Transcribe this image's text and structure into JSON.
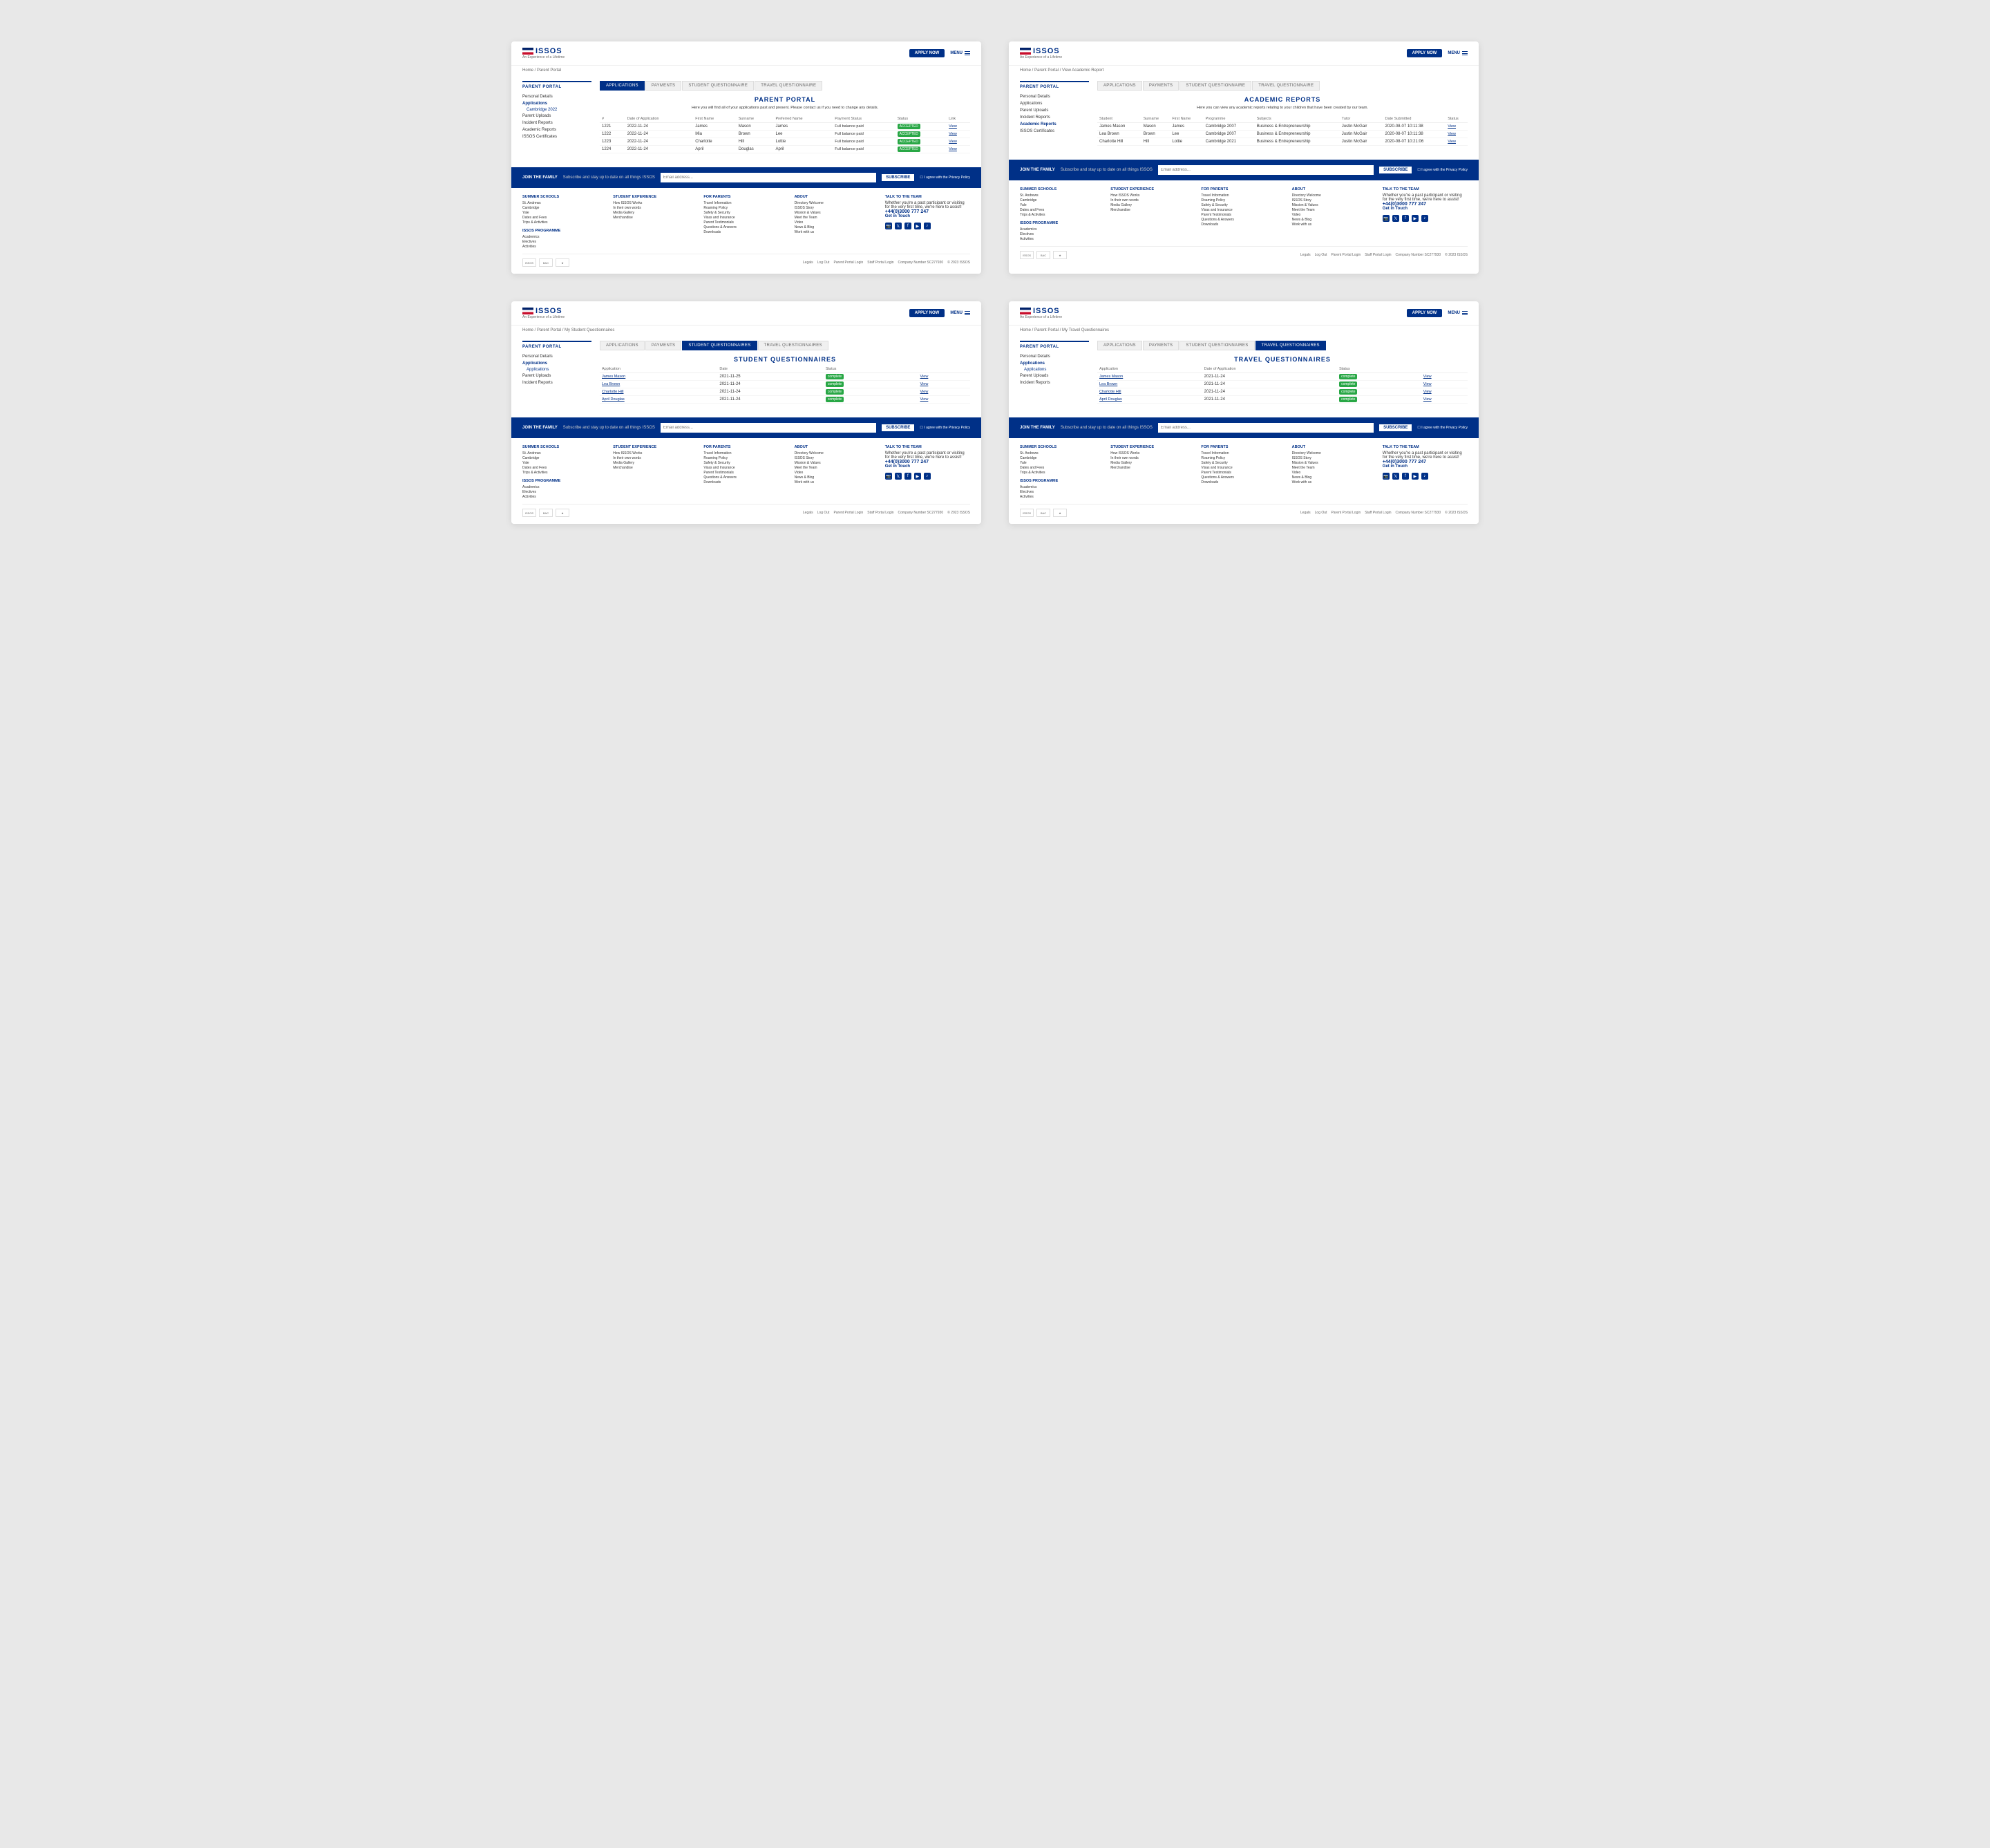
{
  "pages": [
    {
      "id": "page1",
      "type": "applications",
      "breadcrumb": "Home / Parent Portal",
      "tabs": [
        "APPLICATIONS",
        "PAYMENTS",
        "STUDENT QUESTIONNAIRE",
        "TRAVEL QUESTIONNAIRE"
      ],
      "active_tab": 0,
      "sidebar": {
        "title": "PARENT PORTAL",
        "items": [
          "Personal Details",
          "Applications",
          "Parent Uploads",
          "Incident Reports",
          "Academic Reports",
          "ISSOS Certificates"
        ],
        "active": 1,
        "sub_items": [
          "Cambridge 2022"
        ]
      },
      "main_title": "PARENT PORTAL",
      "main_subtitle": "Here you will find all of your applications past and present. Please contact us if you need to change any details.",
      "table": {
        "headers": [
          "#",
          "Date of Application",
          "First Name",
          "Surname",
          "Preferred Name",
          "Payment Status",
          "Status",
          "Link"
        ],
        "rows": [
          [
            "1221",
            "2022-11-24",
            "James",
            "Mason",
            "James",
            "Full balance paid",
            "ACCEPTED",
            "View"
          ],
          [
            "1222",
            "2022-11-24",
            "Mia",
            "Brown",
            "Lee",
            "Full balance paid",
            "ACCEPTED",
            "View"
          ],
          [
            "1223",
            "2022-11-24",
            "Charlotte",
            "Hill",
            "Lottie",
            "Full balance paid",
            "ACCEPTED",
            "View"
          ],
          [
            "1224",
            "2022-11-24",
            "April",
            "Douglas",
            "April",
            "Full balance paid",
            "ACCEPTED",
            "View"
          ]
        ]
      }
    },
    {
      "id": "page2",
      "type": "academic_reports",
      "breadcrumb": "Home / Parent Portal / View Academic Report",
      "tabs": [
        "APPLICATIONS",
        "PAYMENTS",
        "STUDENT QUESTIONNAIRE",
        "TRAVEL QUESTIONNAIRE"
      ],
      "active_tab": -1,
      "sidebar": {
        "title": "PARENT PORTAL",
        "items": [
          "Personal Details",
          "Applications",
          "Parent Uploads",
          "Incident Reports",
          "Academic Reports",
          "ISSOS Certificates"
        ],
        "active": 4,
        "sub_items": []
      },
      "main_title": "ACADEMIC REPORTS",
      "main_subtitle": "Here you can view any academic reports relating to your children that have been created by our team.",
      "table": {
        "headers": [
          "Student",
          "Surname",
          "First Name",
          "Programme",
          "Subjects",
          "Tutor",
          "Date Submitted",
          "Status"
        ],
        "rows": [
          [
            "James Mason",
            "Mason",
            "James",
            "Cambridge 2007",
            "Business & Entrepreneurship",
            "Justin McGair",
            "2020-08-07 10:11:38",
            "View"
          ],
          [
            "Lea Brown",
            "Brown",
            "Lee",
            "Cambridge 2007",
            "Business & Entrepreneurship",
            "Justin McGair",
            "2020-08-07 10:11:38",
            "View"
          ],
          [
            "Charlotte Hill",
            "Hill",
            "Lottie",
            "Cambridge 2021",
            "Business & Entrepreneurship",
            "Justin McGair",
            "2020-08-07 10:21:06",
            "View"
          ]
        ]
      }
    },
    {
      "id": "page3",
      "type": "student_questionnaires",
      "breadcrumb": "Home / Parent Portal / My Student Questionnaires",
      "tabs": [
        "APPLICATIONS",
        "PAYMENTS",
        "STUDENT QUESTIONNAIRES",
        "TRAVEL QUESTIONNAIRES"
      ],
      "active_tab": 2,
      "sidebar": {
        "title": "PARENT PORTAL",
        "items": [
          "Personal Details",
          "Applications",
          "Parent Uploads",
          "Incident Reports"
        ],
        "active": 1,
        "sub_items": [
          "Applications"
        ]
      },
      "main_title": "STUDENT QUESTIONNAIRES",
      "table": {
        "headers": [
          "Application",
          "Date",
          "Status",
          ""
        ],
        "rows": [
          [
            "James Mason",
            "2021-11-25",
            "complete",
            "View"
          ],
          [
            "Lea Brown",
            "2021-11-24",
            "complete",
            "View"
          ],
          [
            "Charlotte Hill",
            "2021-11-24",
            "complete",
            "View"
          ],
          [
            "April Douglas",
            "2021-11-24",
            "complete",
            "View"
          ]
        ]
      }
    },
    {
      "id": "page4",
      "type": "travel_questionnaires",
      "breadcrumb": "Home / Parent Portal / My Travel Questionnaires",
      "tabs": [
        "APPLICATIONS",
        "PAYMENTS",
        "STUDENT QUESTIONNAIRES",
        "TRAVEL QUESTIONNAIRES"
      ],
      "active_tab": 3,
      "sidebar": {
        "title": "PARENT PORTAL",
        "items": [
          "Personal Details",
          "Applications",
          "Parent Uploads",
          "Incident Reports"
        ],
        "active": 1,
        "sub_items": [
          "Applications"
        ]
      },
      "main_title": "TRAVEL QUESTIONNAIRES",
      "table": {
        "headers": [
          "Application",
          "Date of Application",
          "Status",
          ""
        ],
        "rows": [
          [
            "James Mason",
            "2021-11-24",
            "complete",
            "View"
          ],
          [
            "Lea Brown",
            "2021-11-24",
            "complete",
            "View"
          ],
          [
            "Charlotte Hill",
            "2021-11-24",
            "complete",
            "View"
          ],
          [
            "April Douglas",
            "2021-11-24",
            "complete",
            "View"
          ]
        ]
      }
    }
  ],
  "shared": {
    "logo_text": "ISSOS",
    "logo_subtitle": "An Experience of a Lifetime",
    "apply_btn": "APPLY NOW",
    "menu_label": "MENU",
    "newsletter_text": "JOIN THE FAMILY",
    "newsletter_desc": "Subscribe and stay up to date on all things ISSOS",
    "newsletter_btn": "SUBSCRIBE",
    "newsletter_agree": "I agree with the Privacy Policy",
    "footer": {
      "cols": [
        {
          "title": "SUMMER SCHOOLS",
          "links": [
            "St. Andrews",
            "Cambridge",
            "Yale",
            "Dates and Fees",
            "Trips & Activities"
          ]
        },
        {
          "title": "STUDENT EXPERIENCE",
          "links": [
            "How ISSOS Works",
            "In their own words",
            "Media Gallery",
            "Merchandise"
          ]
        },
        {
          "title": "FOR PARENTS",
          "links": [
            "Travel Information",
            "Roaming Policy",
            "Safety & Security",
            "Visas and Insurance",
            "Parent Testimonials",
            "Questions & Answers",
            "Downloads"
          ]
        },
        {
          "title": "ABOUT",
          "links": [
            "Directory Welcome",
            "ISSOS Story",
            "Mission & Values",
            "Meet the Team",
            "Video",
            "News & Blog",
            "Work with us"
          ]
        },
        {
          "title": "TALK TO THE TEAM",
          "desc": "Whether you're a past participant or visiting for the very first time, we're here to assist!",
          "phone": "+44(0)3000 777 247",
          "cta": "Get in Touch"
        }
      ],
      "issos_programme": {
        "title": "ISSOS PROGRAMME",
        "links": [
          "Academics",
          "Electives",
          "Activities"
        ]
      },
      "social_icons": [
        "instagram",
        "twitter",
        "facebook",
        "youtube",
        "tiktok"
      ],
      "legal_links": [
        "Legals",
        "Log Out",
        "Parent Portal Login",
        "Staff Portal Login"
      ],
      "company": "Company Number SC277930",
      "copyright": "© 2023 ISSOS"
    }
  }
}
